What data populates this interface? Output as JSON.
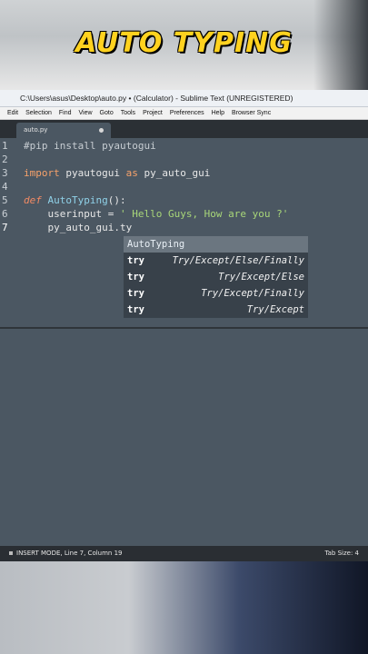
{
  "banner": {
    "title": "AUTO TYPING"
  },
  "window": {
    "title": "C:\\Users\\asus\\Desktop\\auto.py • (Calculator) - Sublime Text (UNREGISTERED)"
  },
  "menu": [
    "Edit",
    "Selection",
    "Find",
    "View",
    "Goto",
    "Tools",
    "Project",
    "Preferences",
    "Help",
    "Browser Sync"
  ],
  "tab": {
    "label": "auto.py"
  },
  "editor": {
    "line_numbers": [
      "1",
      "2",
      "3",
      "4",
      "5",
      "6",
      "7"
    ],
    "active_line": "7",
    "lines": {
      "l1": "#pip install pyautogui",
      "l3_kw": "import",
      "l3_rest": " pyautogui ",
      "l3_as": "as",
      "l3_alias": " py_auto_gui",
      "l5_def": "def",
      "l5_fn": "AutoTyping",
      "l5_rest": "():",
      "l6_var": "    userinput = ",
      "l6_str": "' Hello Guys, How are you ?'",
      "l7": "    py_auto_gui.ty"
    }
  },
  "autocomplete": {
    "items": [
      {
        "trigger": "AutoTyping",
        "desc": ""
      },
      {
        "trigger": "try",
        "desc": "Try/Except/Else/Finally"
      },
      {
        "trigger": "try",
        "desc": "Try/Except/Else"
      },
      {
        "trigger": "try",
        "desc": "Try/Except/Finally"
      },
      {
        "trigger": "try",
        "desc": "Try/Except"
      }
    ]
  },
  "status": {
    "left": "INSERT MODE, Line 7, Column 19",
    "right": "Tab Size: 4"
  },
  "colors": {
    "editor_bg": "#4b5762",
    "banner_text": "#ffd21f",
    "keyword": "#f7a26b",
    "function": "#8fd1e8",
    "string": "#a8d679"
  }
}
